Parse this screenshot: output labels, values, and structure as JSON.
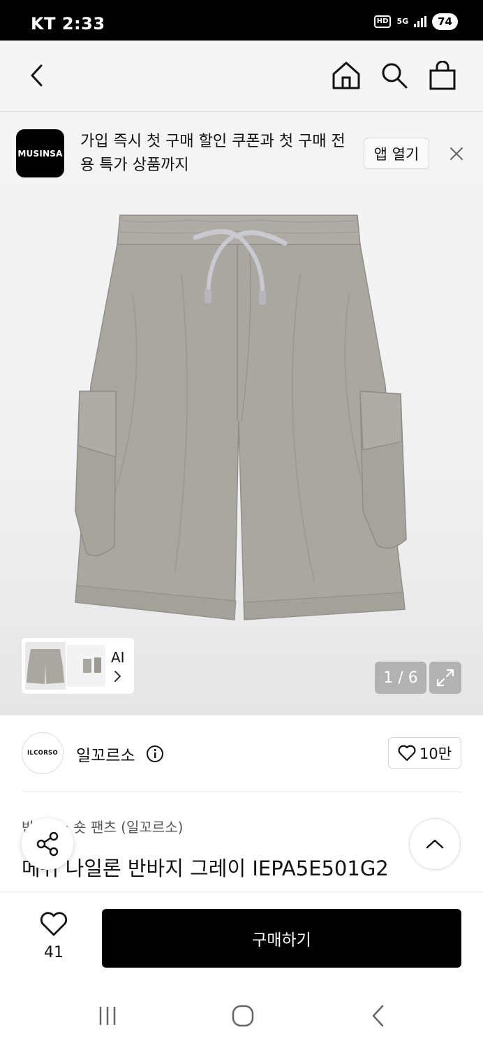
{
  "status_bar": {
    "carrier_time": "KT 2:33",
    "hd": "HD",
    "network": "5G",
    "battery": "74"
  },
  "nav": {
    "back_icon": "back-arrow-icon",
    "home_icon": "home-icon",
    "search_icon": "search-icon",
    "cart_icon": "shopping-bag-icon"
  },
  "banner": {
    "logo_text": "MUSINSA",
    "message": "가입 즉시 첫 구매 할인 쿠폰과 첫 구매 전용 특가 상품까지",
    "open_label": "앱 열기",
    "close_icon": "close-icon"
  },
  "gallery": {
    "ai_label": "AI",
    "counter": "1 / 6",
    "expand_icon": "expand-icon"
  },
  "brand": {
    "logo_text": "ILCORSO",
    "name": "일꼬르소",
    "like_count": "10만"
  },
  "product": {
    "category": "반바지 · 숏 팬츠 (일꼬르소)",
    "name": "메쉬 나일론 반바지 그레이 IEPA5E501G2"
  },
  "actions": {
    "wish_count": "41",
    "buy_label": "구매하기"
  },
  "colors": {
    "product_gray": "#a7a59e",
    "buy_button": "#000000"
  }
}
